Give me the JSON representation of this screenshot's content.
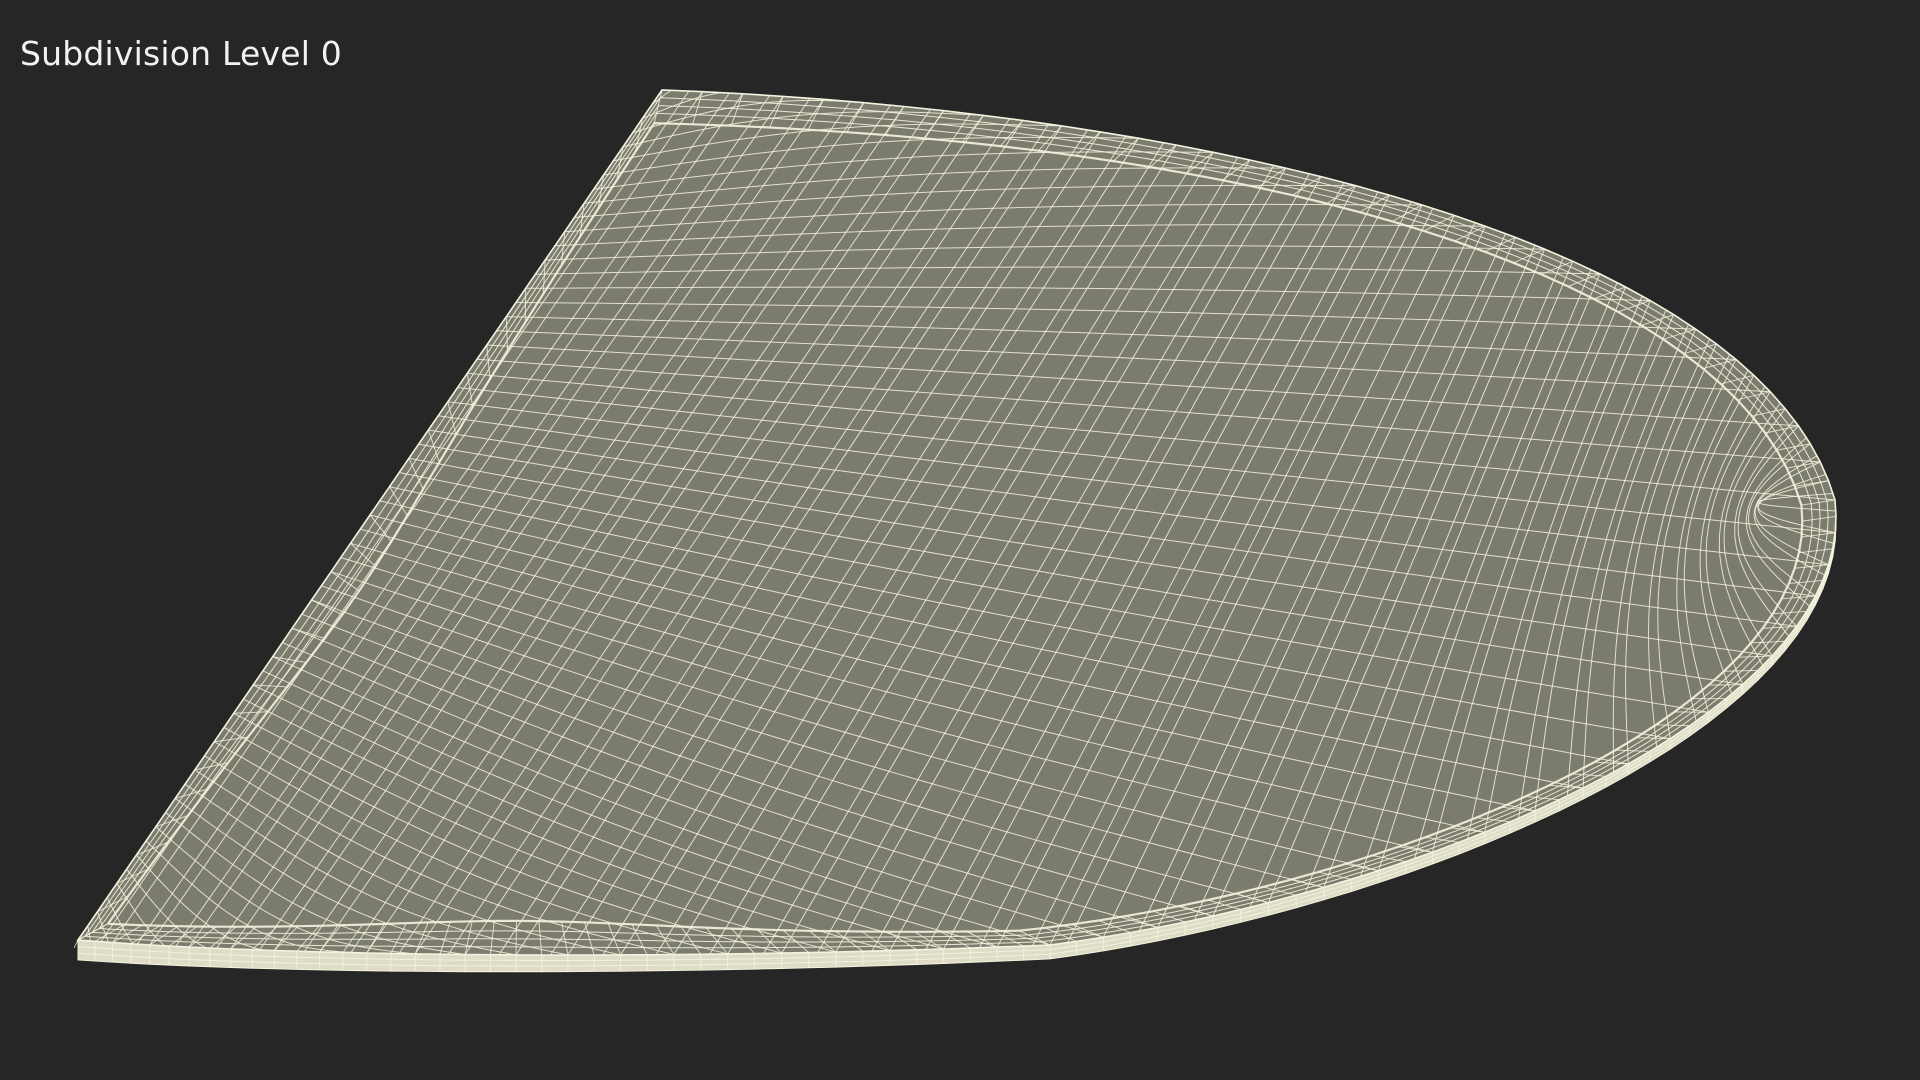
{
  "viewport": {
    "label": "Subdivision Level 0",
    "background_color": "#262626"
  },
  "model": {
    "display_mode": "wireframe-on-shaded",
    "surface_color": "#7b7b6e",
    "wire_color": "#f4f3df",
    "rim_color": "#dedcc6",
    "shape": "quarter-round shelf with raised rim"
  }
}
